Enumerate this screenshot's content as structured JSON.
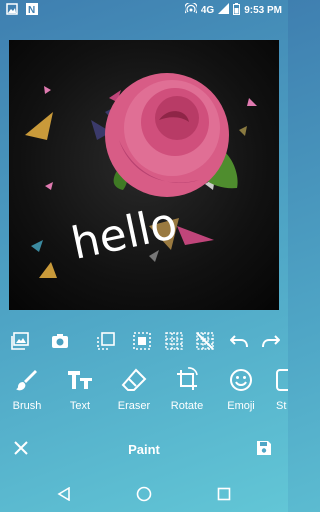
{
  "status_bar": {
    "network": "4G",
    "time": "9:53 PM",
    "icons": [
      "image-notification-icon",
      "n-app-icon",
      "hotspot-icon",
      "signal-icon",
      "battery-icon"
    ]
  },
  "canvas": {
    "text_overlay": "hello",
    "background_color": "#0d0d0d"
  },
  "edit_toolbar": {
    "icons": [
      "gallery-icon",
      "camera-icon",
      "layer-copy-icon",
      "select-area-icon",
      "grid-icon",
      "no-grid-icon",
      "undo-icon",
      "redo-icon"
    ]
  },
  "tools": [
    {
      "label": "Brush",
      "icon": "brush-icon"
    },
    {
      "label": "Text",
      "icon": "text-icon"
    },
    {
      "label": "Eraser",
      "icon": "eraser-icon"
    },
    {
      "label": "Rotate",
      "icon": "rotate-icon"
    },
    {
      "label": "Emoji",
      "icon": "emoji-icon"
    },
    {
      "label": "St",
      "icon": "sticker-icon"
    }
  ],
  "bottom_bar": {
    "title": "Paint",
    "close_icon": "close-icon",
    "save_icon": "save-icon"
  },
  "nav_bar": {
    "icons": [
      "back-icon",
      "home-icon",
      "recents-icon"
    ]
  }
}
